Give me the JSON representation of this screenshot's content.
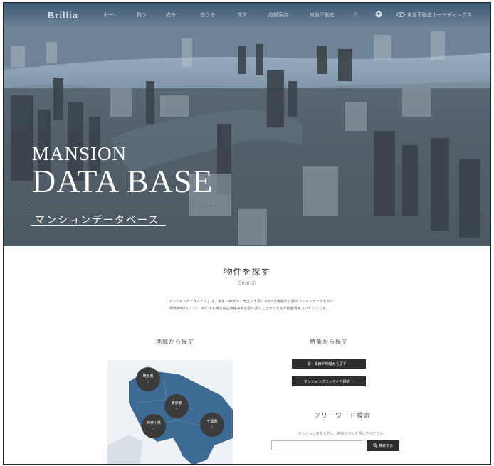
{
  "nav": {
    "brand": "Brillia",
    "items": [
      "ホーム",
      "買う",
      "売る",
      "借りる",
      "貸す",
      "店舗案内",
      "東急不動産"
    ],
    "tokyu_label": "東急不動産ホールディングス",
    "icons": [
      "star-icon",
      "user-icon",
      "tokyu-logo-icon"
    ]
  },
  "hero": {
    "title_line1": "MANSION",
    "title_line2": "DATA BASE",
    "subtitle": "マンションデータベース"
  },
  "search_section": {
    "title": "物件を探す",
    "subtitle": "Search",
    "intro_line1": "「マンションデータベース」は、東京・神奈川・埼玉・千葉にある5万棟超の分譲マンションデータを元に",
    "intro_line2": "販売価格や口コミ、AIによる推定中古価格等がお調べ頂くことができる不動産情報コンテンツです。"
  },
  "area": {
    "title": "地域から探す",
    "regions": [
      "埼玉県",
      "東京都",
      "神奈川県",
      "千葉県"
    ]
  },
  "feature": {
    "title": "特集から探す",
    "buttons": [
      "駅・路線や地域から探す",
      "マンションブランドから探す"
    ]
  },
  "freeword": {
    "title": "フリーワード検索",
    "hint": "マンション名を入力し、検索ボタンを押してください。",
    "placeholder": "",
    "button_label": "検索する"
  },
  "colors": {
    "dark_button": "#2e2e2e",
    "map_land": "#3d6b94",
    "map_bg": "#eef1f5"
  }
}
